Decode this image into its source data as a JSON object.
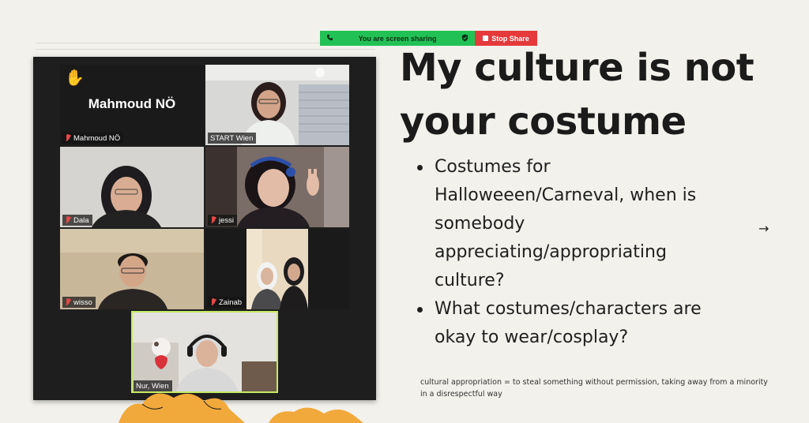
{
  "share_bar": {
    "status_text": "You are screen sharing",
    "stop_label": "Stop Share"
  },
  "participants": [
    {
      "name": "Mahmoud NÖ",
      "display_name": "Mahmoud NÖ",
      "video": false,
      "muted": true,
      "hand_raised": true
    },
    {
      "name": "START Wien",
      "video": true,
      "muted": false
    },
    {
      "name": "Dala",
      "video": true,
      "muted": true
    },
    {
      "name": "jessi",
      "video": true,
      "muted": true
    },
    {
      "name": "wisso",
      "video": true,
      "muted": true
    },
    {
      "name": "Zainab",
      "video": true,
      "muted": true
    },
    {
      "name": "Nur, Wien",
      "video": true,
      "muted": false,
      "active_speaker": true
    }
  ],
  "slide": {
    "title_line1": "My culture is not",
    "title_line2": "your costume",
    "bullets": [
      "Costumes for Halloweeen/Carneval, when is somebody appreciating/appropriating culture?",
      "What costumes/characters are okay to wear/cosplay?"
    ],
    "footnote": "cultural appropriation = to steal something without permission, taking away from a minority in a disrespectful way",
    "next_icon": "arrow-right-icon"
  },
  "colors": {
    "share_green": "#22c155",
    "stop_red": "#e5393b",
    "active_outline": "#c6ea64",
    "slide_bg": "#f2f1ec",
    "deco_orange": "#f2a93b"
  }
}
